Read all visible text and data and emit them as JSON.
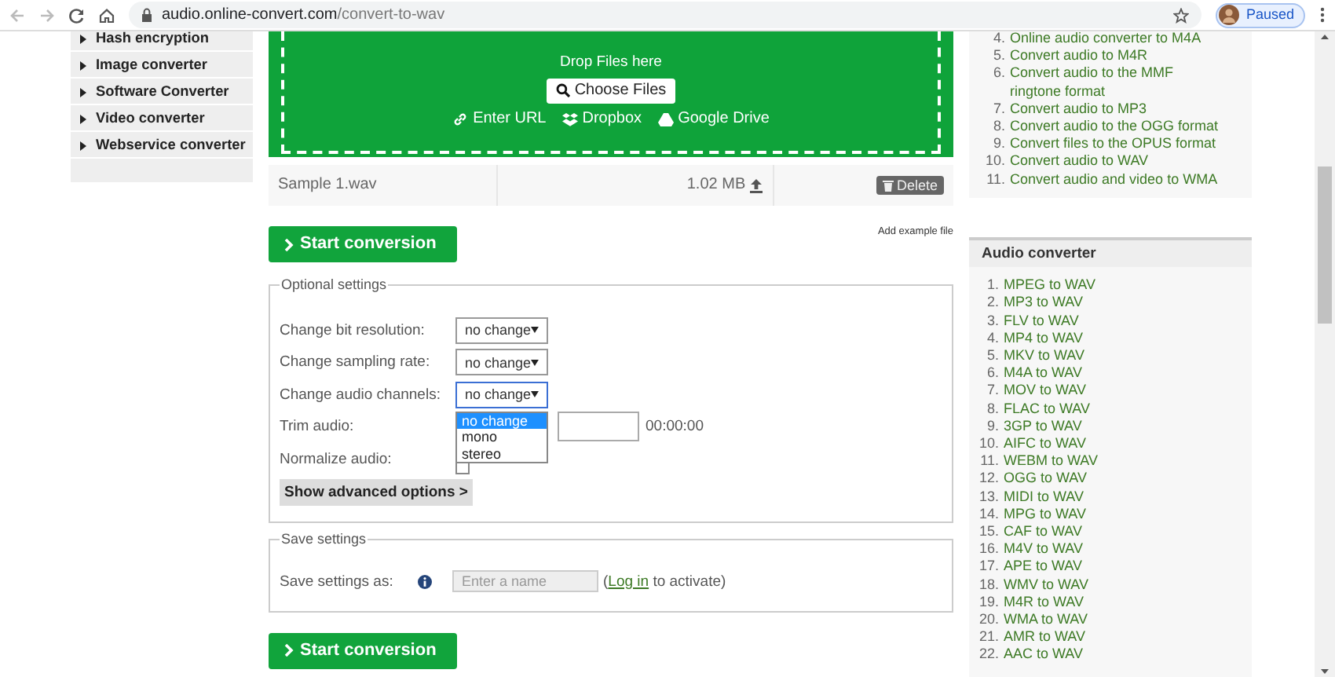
{
  "browser": {
    "url_host": "audio.online-convert.com",
    "url_path": "/convert-to-wav",
    "profile_label": "Paused"
  },
  "sidebar": {
    "items": [
      {
        "label": "Hash encryption"
      },
      {
        "label": "Image converter"
      },
      {
        "label": "Software Converter"
      },
      {
        "label": "Video converter"
      },
      {
        "label": "Webservice converter"
      }
    ]
  },
  "dropzone": {
    "title": "Drop Files here",
    "choose_button": "Choose Files",
    "sources": [
      {
        "kind": "url",
        "label": "Enter URL"
      },
      {
        "kind": "dropbox",
        "label": "Dropbox"
      },
      {
        "kind": "drive",
        "label": "Google Drive"
      }
    ]
  },
  "file": {
    "name": "Sample 1.wav",
    "size": "1.02 MB",
    "delete_button": "Delete"
  },
  "add_example": "Add example file",
  "start_button": "Start conversion",
  "optional_settings": {
    "legend": "Optional settings",
    "rows": [
      {
        "kind": "select",
        "label": "Change bit resolution:",
        "value": "no change",
        "open": false
      },
      {
        "kind": "select",
        "label": "Change sampling rate:",
        "value": "no change",
        "open": false
      },
      {
        "kind": "select",
        "label": "Change audio channels:",
        "value": "no change",
        "open": true,
        "options": [
          {
            "label": "no change",
            "selected": true
          },
          {
            "label": "mono",
            "selected": false
          },
          {
            "label": "stereo",
            "selected": false
          }
        ]
      },
      {
        "kind": "trim",
        "label": "Trim audio:",
        "end_time": "00:00:00"
      },
      {
        "kind": "checkbox",
        "label": "Normalize audio:",
        "checked": false
      }
    ],
    "advanced_button": "Show advanced options >"
  },
  "save_settings": {
    "legend": "Save settings",
    "label": "Save settings as:",
    "placeholder": "Enter a name",
    "login_link": "Log in",
    "login_suffix": " to activate)",
    "login_prefix": "("
  },
  "start_button_bottom": "Start conversion",
  "related": {
    "items": [
      {
        "number": "4.",
        "label": "Online audio converter to M4A"
      },
      {
        "number": "5.",
        "label": "Convert audio to M4R"
      },
      {
        "number": "6.",
        "label": "Convert audio to the MMF ringtone format"
      },
      {
        "number": "7.",
        "label": "Convert audio to MP3"
      },
      {
        "number": "8.",
        "label": "Convert audio to the OGG format"
      },
      {
        "number": "9.",
        "label": "Convert files to the OPUS format"
      },
      {
        "number": "10.",
        "label": "Convert audio to WAV"
      },
      {
        "number": "11.",
        "label": "Convert audio and video to WMA"
      }
    ]
  },
  "audio_converter": {
    "title": "Audio converter",
    "items": [
      {
        "number": "1.",
        "label": "MPEG to WAV"
      },
      {
        "number": "2.",
        "label": "MP3 to WAV"
      },
      {
        "number": "3.",
        "label": "FLV to WAV"
      },
      {
        "number": "4.",
        "label": "MP4 to WAV"
      },
      {
        "number": "5.",
        "label": "MKV to WAV"
      },
      {
        "number": "6.",
        "label": "M4A to WAV"
      },
      {
        "number": "7.",
        "label": "MOV to WAV"
      },
      {
        "number": "8.",
        "label": "FLAC to WAV"
      },
      {
        "number": "9.",
        "label": "3GP to WAV"
      },
      {
        "number": "10.",
        "label": "AIFC to WAV"
      },
      {
        "number": "11.",
        "label": "WEBM to WAV"
      },
      {
        "number": "12.",
        "label": "OGG to WAV"
      },
      {
        "number": "13.",
        "label": "MIDI to WAV"
      },
      {
        "number": "14.",
        "label": "MPG to WAV"
      },
      {
        "number": "15.",
        "label": "CAF to WAV"
      },
      {
        "number": "16.",
        "label": "M4V to WAV"
      },
      {
        "number": "17.",
        "label": "APE to WAV"
      },
      {
        "number": "18.",
        "label": "WMV to WAV"
      },
      {
        "number": "19.",
        "label": "M4R to WAV"
      },
      {
        "number": "20.",
        "label": "WMA to WAV"
      },
      {
        "number": "21.",
        "label": "AMR to WAV"
      },
      {
        "number": "22.",
        "label": "AAC to WAV"
      }
    ]
  }
}
